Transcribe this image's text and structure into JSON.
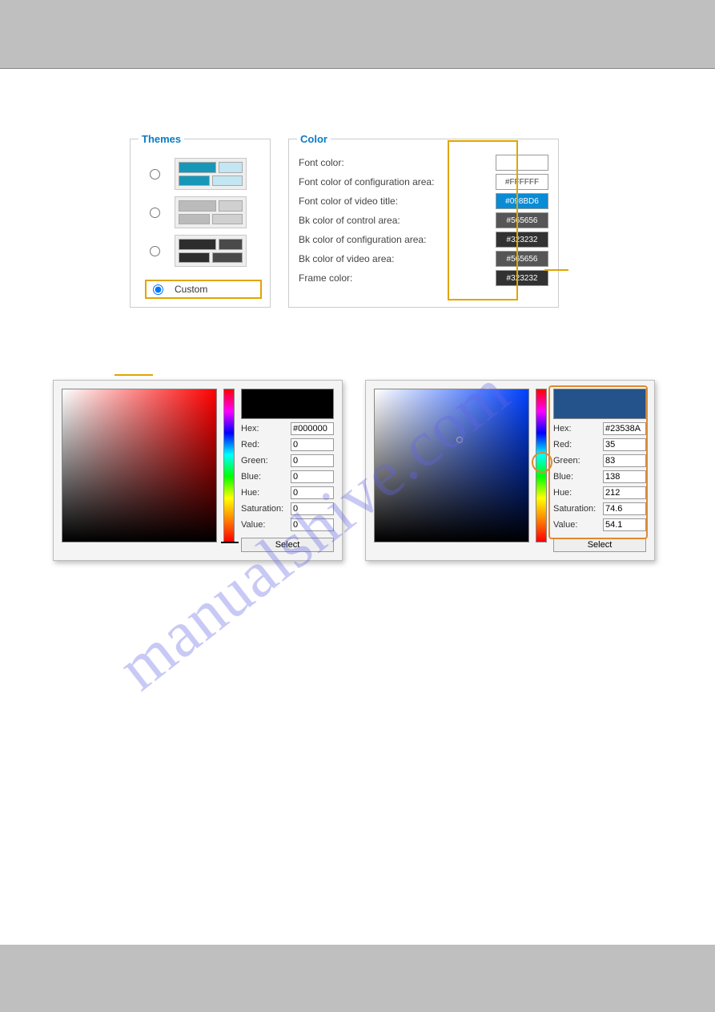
{
  "watermark": "manualshive.com",
  "themes": {
    "legend": "Themes",
    "custom_label": "Custom"
  },
  "color": {
    "legend": "Color",
    "rows": [
      {
        "label": "Font color:",
        "value": "",
        "bg": "#ffffff",
        "textclass": "white"
      },
      {
        "label": "Font color of configuration area:",
        "value": "#FFFFFF",
        "bg": "#ffffff",
        "textclass": "white"
      },
      {
        "label": "Font color of video title:",
        "value": "#098BD6",
        "bg": "#098BD6",
        "textclass": ""
      },
      {
        "label": "Bk color of control area:",
        "value": "#565656",
        "bg": "#565656",
        "textclass": ""
      },
      {
        "label": "Bk color of configuration area:",
        "value": "#323232",
        "bg": "#323232",
        "textclass": ""
      },
      {
        "label": "Bk color of video area:",
        "value": "#565656",
        "bg": "#565656",
        "textclass": ""
      },
      {
        "label": "Frame color:",
        "value": "#323232",
        "bg": "#323232",
        "textclass": ""
      }
    ]
  },
  "picker1": {
    "preview": "#000000",
    "hex": "#000000",
    "red": "0",
    "green": "0",
    "blue": "0",
    "hue": "0",
    "saturation": "0",
    "value": "0",
    "select": "Select",
    "labels": {
      "hex": "Hex:",
      "red": "Red:",
      "green": "Green:",
      "blue": "Blue:",
      "hue": "Hue:",
      "sat": "Saturation:",
      "val": "Value:"
    }
  },
  "picker2": {
    "preview": "#23538A",
    "hex": "#23538A",
    "red": "35",
    "green": "83",
    "blue": "138",
    "hue": "212",
    "saturation": "74.6",
    "value": "54.1",
    "select": "Select",
    "labels": {
      "hex": "Hex:",
      "red": "Red:",
      "green": "Green:",
      "blue": "Blue:",
      "hue": "Hue:",
      "sat": "Saturation:",
      "val": "Value:"
    }
  }
}
